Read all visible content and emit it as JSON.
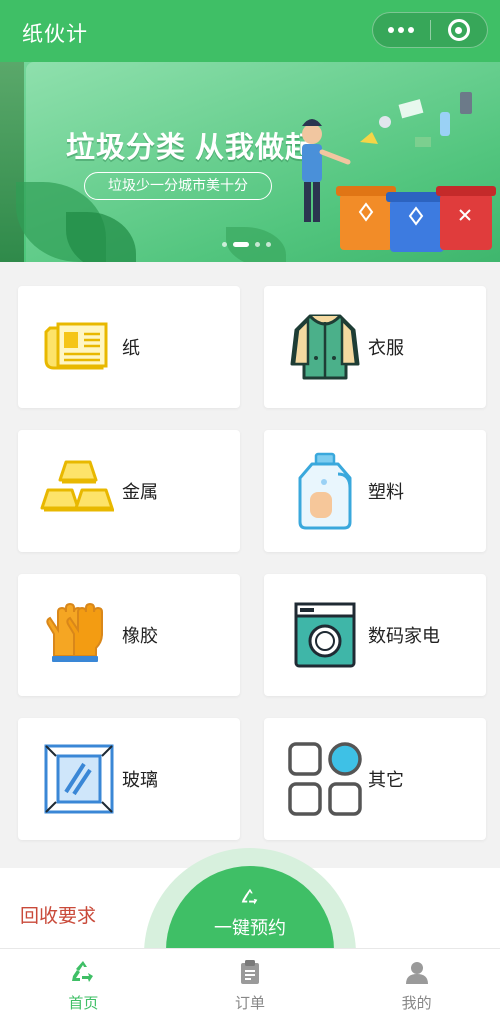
{
  "header": {
    "title": "纸伙计",
    "more_icon": "more-dots-icon",
    "close_icon": "target-icon"
  },
  "banner": {
    "slogan": "垃圾分类 从我做起",
    "subslogan": "垃圾少一分城市美十分",
    "active_index": 1,
    "slide_count": 4
  },
  "categories": [
    {
      "label": "纸",
      "icon": "newspaper-icon"
    },
    {
      "label": "衣服",
      "icon": "clothes-icon"
    },
    {
      "label": "金属",
      "icon": "gold-bars-icon"
    },
    {
      "label": "塑料",
      "icon": "plastic-bottle-icon"
    },
    {
      "label": "橡胶",
      "icon": "rubber-gloves-icon"
    },
    {
      "label": "数码家电",
      "icon": "washing-machine-icon"
    },
    {
      "label": "玻璃",
      "icon": "glass-icon"
    },
    {
      "label": "其它",
      "icon": "others-grid-icon"
    }
  ],
  "requirements": {
    "title": "回收要求"
  },
  "book_button": {
    "label": "一键预约"
  },
  "tabbar": [
    {
      "label": "首页",
      "icon": "recycle-icon",
      "active": true
    },
    {
      "label": "订单",
      "icon": "clipboard-icon",
      "active": false
    },
    {
      "label": "我的",
      "icon": "user-icon",
      "active": false
    }
  ],
  "colors": {
    "brand": "#3fbf66",
    "requirements_title": "#c94a3a",
    "tab_inactive": "#888888"
  }
}
